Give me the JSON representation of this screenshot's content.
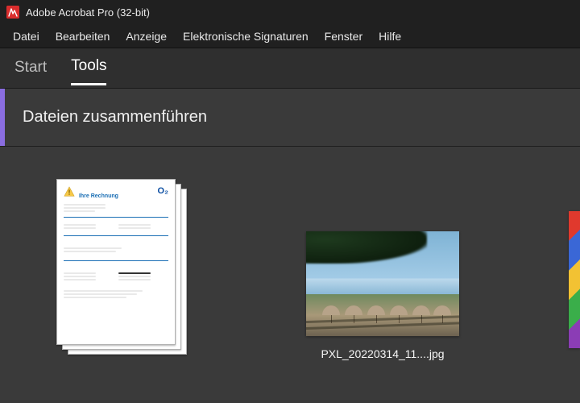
{
  "app": {
    "title": "Adobe Acrobat Pro (32-bit)"
  },
  "menu": {
    "items": [
      "Datei",
      "Bearbeiten",
      "Anzeige",
      "Elektronische Signaturen",
      "Fenster",
      "Hilfe"
    ]
  },
  "tabs": {
    "items": [
      {
        "label": "Start",
        "active": false
      },
      {
        "label": "Tools",
        "active": true
      }
    ]
  },
  "tool": {
    "title": "Dateien zusammenführen",
    "accent_color": "#8a6de0"
  },
  "files": [
    {
      "kind": "pdf-stack",
      "invoice_header": "Ihre Rechnung",
      "brand": "O₂",
      "label": ""
    },
    {
      "kind": "photo",
      "label": "PXL_20220314_11....jpg"
    }
  ]
}
